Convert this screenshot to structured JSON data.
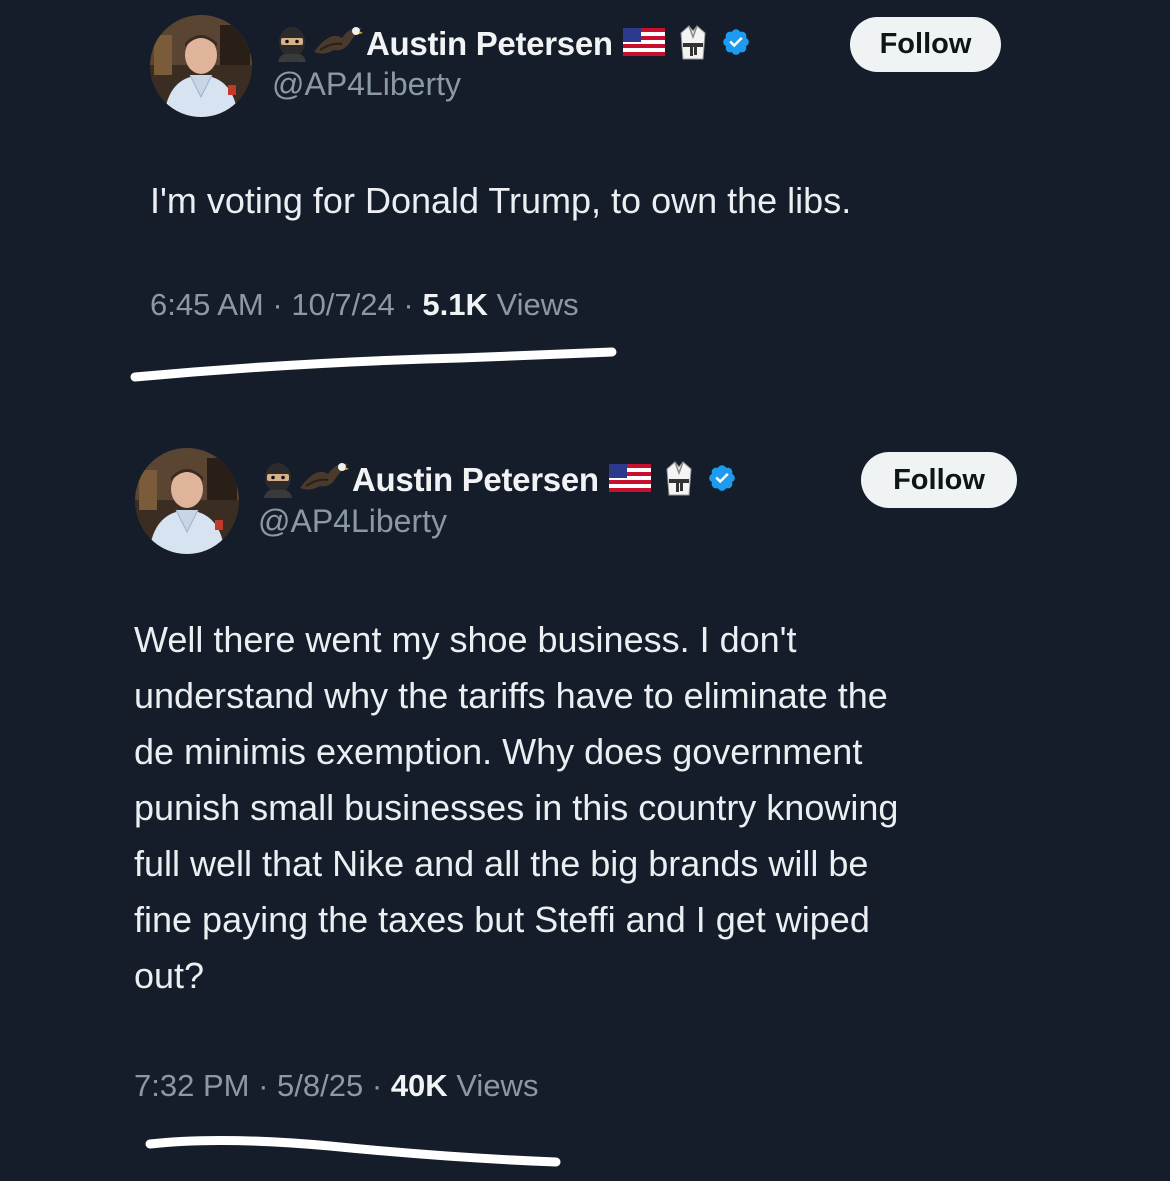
{
  "colors": {
    "background": "#151d2a",
    "text_primary": "#e7e9ea",
    "text_secondary": "#8b98a5",
    "verified_badge": "#1d9bf0",
    "follow_button_bg": "#eff3f4"
  },
  "tweets": [
    {
      "author": {
        "display_name": "Austin Petersen",
        "handle": "@AP4Liberty",
        "emoji_prefix_icons": [
          "ninja-icon",
          "eagle-icon"
        ],
        "emoji_suffix_icons": [
          "us-flag-icon",
          "martial-arts-uniform-icon",
          "verified-badge-icon"
        ]
      },
      "follow_label": "Follow",
      "text": "I'm voting for Donald Trump, to own the libs.",
      "meta": {
        "time": "6:45 AM",
        "separator": "·",
        "date": "10/7/24",
        "views_count": "5.1K",
        "views_label": "Views"
      }
    },
    {
      "author": {
        "display_name": "Austin Petersen",
        "handle": "@AP4Liberty",
        "emoji_prefix_icons": [
          "ninja-icon",
          "eagle-icon"
        ],
        "emoji_suffix_icons": [
          "us-flag-icon",
          "martial-arts-uniform-icon",
          "verified-badge-icon"
        ]
      },
      "follow_label": "Follow",
      "text_lines": [
        "Well there went my shoe business. I don't",
        "understand why the tariffs have to eliminate the",
        "de minimis exemption. Why does government",
        "punish small businesses in this country knowing",
        "full well that Nike and all the big brands will be",
        "fine paying the taxes but Steffi and I get wiped",
        "out?"
      ],
      "meta": {
        "time": "7:32 PM",
        "separator": "·",
        "date": "5/8/25",
        "views_count": "40K",
        "views_label": "Views"
      }
    }
  ]
}
